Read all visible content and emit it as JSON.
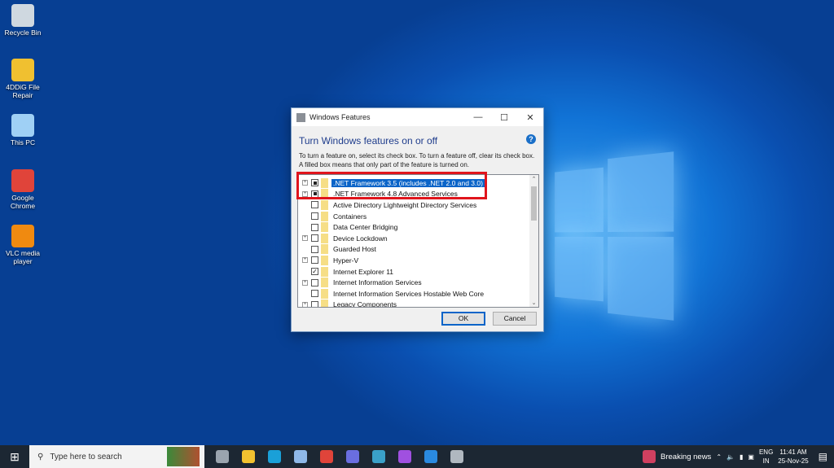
{
  "desktop": {
    "icons": [
      {
        "label": "Recycle Bin",
        "icon": "recycle-bin-icon",
        "color": "#cfd8e0"
      },
      {
        "label": "4DDiG File Repair",
        "icon": "file-repair-icon",
        "color": "#f0c030"
      },
      {
        "label": "This PC",
        "icon": "computer-icon",
        "color": "#9fd0f5"
      },
      {
        "label": "Google Chrome",
        "icon": "chrome-icon",
        "color": "#e0443a"
      },
      {
        "label": "VLC media player",
        "icon": "vlc-icon",
        "color": "#f08a10"
      }
    ]
  },
  "dialog": {
    "title": "Windows Features",
    "heading": "Turn Windows features on or off",
    "description": "To turn a feature on, select its check box. To turn a feature off, clear its check box. A filled box means that only part of the feature is turned on.",
    "features": [
      {
        "label": ".NET Framework 3.5 (includes .NET 2.0 and 3.0)",
        "state": "partial",
        "expandable": true,
        "selected": true
      },
      {
        "label": ".NET Framework 4.8 Advanced Services",
        "state": "partial",
        "expandable": true
      },
      {
        "label": "Active Directory Lightweight Directory Services",
        "state": "unchecked",
        "expandable": false
      },
      {
        "label": "Containers",
        "state": "unchecked",
        "expandable": false
      },
      {
        "label": "Data Center Bridging",
        "state": "unchecked",
        "expandable": false
      },
      {
        "label": "Device Lockdown",
        "state": "unchecked",
        "expandable": true
      },
      {
        "label": "Guarded Host",
        "state": "unchecked",
        "expandable": false
      },
      {
        "label": "Hyper-V",
        "state": "unchecked",
        "expandable": true
      },
      {
        "label": "Internet Explorer 11",
        "state": "checked",
        "expandable": false
      },
      {
        "label": "Internet Information Services",
        "state": "unchecked",
        "expandable": true
      },
      {
        "label": "Internet Information Services Hostable Web Core",
        "state": "unchecked",
        "expandable": false
      },
      {
        "label": "Legacy Components",
        "state": "unchecked",
        "expandable": true
      }
    ],
    "ok_label": "OK",
    "cancel_label": "Cancel",
    "highlight_color": "#e0141c"
  },
  "taskbar": {
    "search_placeholder": "Type here to search",
    "apps": [
      {
        "icon": "task-view-icon",
        "color": "#9aa4ae"
      },
      {
        "icon": "file-explorer-icon",
        "color": "#f2c230"
      },
      {
        "icon": "edge-icon",
        "color": "#1aa0d8"
      },
      {
        "icon": "notepad-icon",
        "color": "#8fb8e8"
      },
      {
        "icon": "chrome-icon",
        "color": "#e0443a"
      },
      {
        "icon": "teams-icon",
        "color": "#6a6ee0"
      },
      {
        "icon": "app-icon",
        "color": "#3aa0c8"
      },
      {
        "icon": "video-editor-icon",
        "color": "#a050e0"
      },
      {
        "icon": "c-app-icon",
        "color": "#2a8ae0"
      },
      {
        "icon": "file-icon",
        "color": "#b0b8c0"
      }
    ],
    "news": "Breaking news",
    "language": "ENG",
    "region": "IN",
    "time": "11:41 AM",
    "date": "25-Nov-25"
  }
}
